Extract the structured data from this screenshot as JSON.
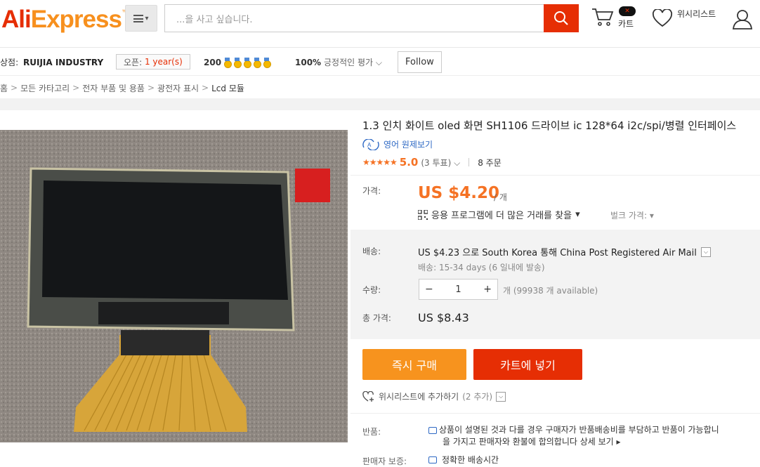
{
  "header": {
    "logo_ali": "Ali",
    "logo_express": "Express",
    "logo_tm": "™",
    "search_placeholder": "...을 사고 싶습니다.",
    "cart_label": "카트",
    "wishlist_label": "위시리스트"
  },
  "store": {
    "label": "상점:",
    "name": "RUIJIA INDUSTRY",
    "open_label": "오픈:",
    "open_years": "1 year(s)",
    "score": "200",
    "positive_pct": "100%",
    "positive_label": "긍정적인 평가",
    "follow_label": "Follow"
  },
  "breadcrumb": [
    "홈",
    "모든 카타고리",
    "전자 부품 및 용품",
    "광전자 표시",
    "Lcd 모듈"
  ],
  "product": {
    "title": "1.3 인치 화이트 oled 화면 SH1106 드라이브 ic 128*64 i2c/spi/병렬 인터페이스",
    "translate_label": "영어 원제보기",
    "stars": "★★★★★",
    "rating": "5.0",
    "votes": "(3 투표)",
    "orders": "8 주문"
  },
  "price": {
    "label": "가격:",
    "value": "US $4.20",
    "unit": "/ 개",
    "app_deal": "응용 프로그램에 더 많은 거래를 찾을",
    "bulk_label": "벌크 가격:"
  },
  "shipping": {
    "label": "배송:",
    "main": "US $4.23 으로 South Korea 통해 China Post Registered Air Mail",
    "sub": "배송: 15-34 days (6 일내에 발송)"
  },
  "quantity": {
    "label": "수량:",
    "value": "1",
    "available": "개 (99938 개 available)"
  },
  "total": {
    "label": "총 가격:",
    "value": "US $8.43"
  },
  "actions": {
    "buy_now": "즉시 구매",
    "add_cart": "카트에 넣기",
    "wishlist_add": "위시리스트에 추가하기",
    "wishlist_count": "(2 추가)"
  },
  "returns": {
    "label": "반품:",
    "line1": "상품이 설명된 것과 다를 경우 구매자가 반품배송비를 부담하고 반품이 가능합니",
    "line2": "을 가지고 판매자와 환불에 합의합니다 상세 보기"
  },
  "guarantee": {
    "label": "판매자 보증:",
    "text": "정확한 배송시간"
  },
  "colors": {
    "brand": "#e62e04",
    "accent": "#f7931e",
    "price": "#f57224",
    "link": "#2d68c4"
  }
}
